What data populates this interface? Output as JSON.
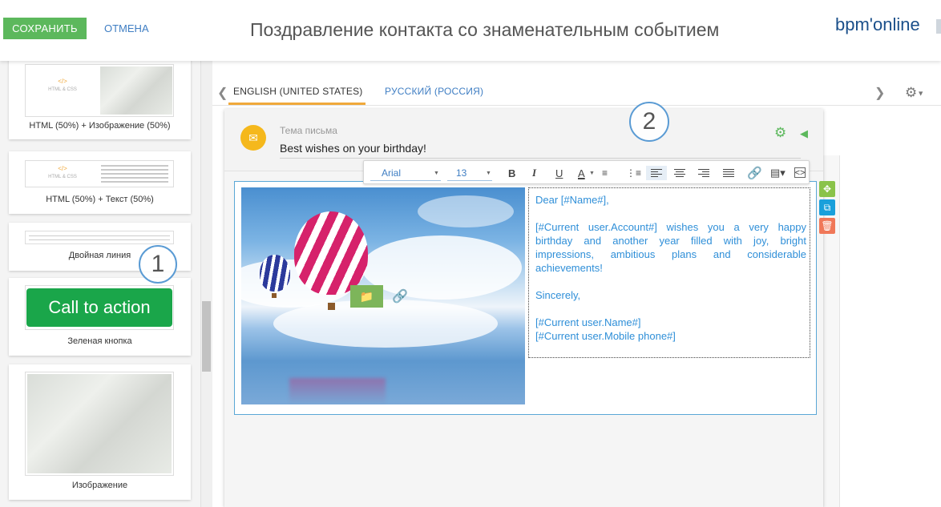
{
  "header": {
    "save_label": "СОХРАНИТЬ",
    "cancel_label": "ОТМЕНА",
    "title": "Поздравление контакта со знаменательным событием",
    "logo_text": "bpm'online"
  },
  "blocks": [
    {
      "caption": "HTML (50%) + Изображение (50%)",
      "thumb_tag": "</>",
      "thumb_text": "HTML & CSS"
    },
    {
      "caption": "HTML (50%) + Текст (50%)",
      "thumb_tag": "</>",
      "thumb_text": "HTML & CSS"
    },
    {
      "caption": "Двойная линия"
    },
    {
      "caption": "Зеленая кнопка",
      "button_text": "Call to action"
    },
    {
      "caption": "Изображение"
    }
  ],
  "callouts": {
    "one": "1",
    "two": "2"
  },
  "tabs": [
    {
      "label": "ENGLISH (UNITED STATES)",
      "active": true
    },
    {
      "label": "РУССКИЙ (РОССИЯ)",
      "active": false
    }
  ],
  "subject": {
    "label": "Тема письма",
    "value": "Best wishes on your birthday!"
  },
  "toolbar": {
    "font": "Arial",
    "size": "13",
    "bold": "B",
    "italic": "I",
    "underline": "U",
    "font_color": "A"
  },
  "email_text": {
    "greeting": "Dear [#Name#],",
    "body": "[#Current user.Account#] wishes you a very happy birthday and another year filled with joy, bright impressions, ambitious plans and considerable achievements!",
    "closing": "Sincerely,",
    "sign_name": "[#Current user.Name#]",
    "sign_phone": "[#Current user.Mobile phone#]"
  },
  "icons": {
    "tab_prev": "chevron-left-icon",
    "tab_next": "chevron-right-icon",
    "settings": "gear-icon",
    "subject": "envelope-icon",
    "move": "move-icon",
    "copy": "copy-icon",
    "delete": "trash-icon"
  },
  "colors": {
    "save_button": "#5cb85c",
    "link": "#3f7ec3",
    "active_tab_underline": "#f0a93b",
    "email_text": "#2f8fd8",
    "cta_button": "#1aa64a"
  }
}
